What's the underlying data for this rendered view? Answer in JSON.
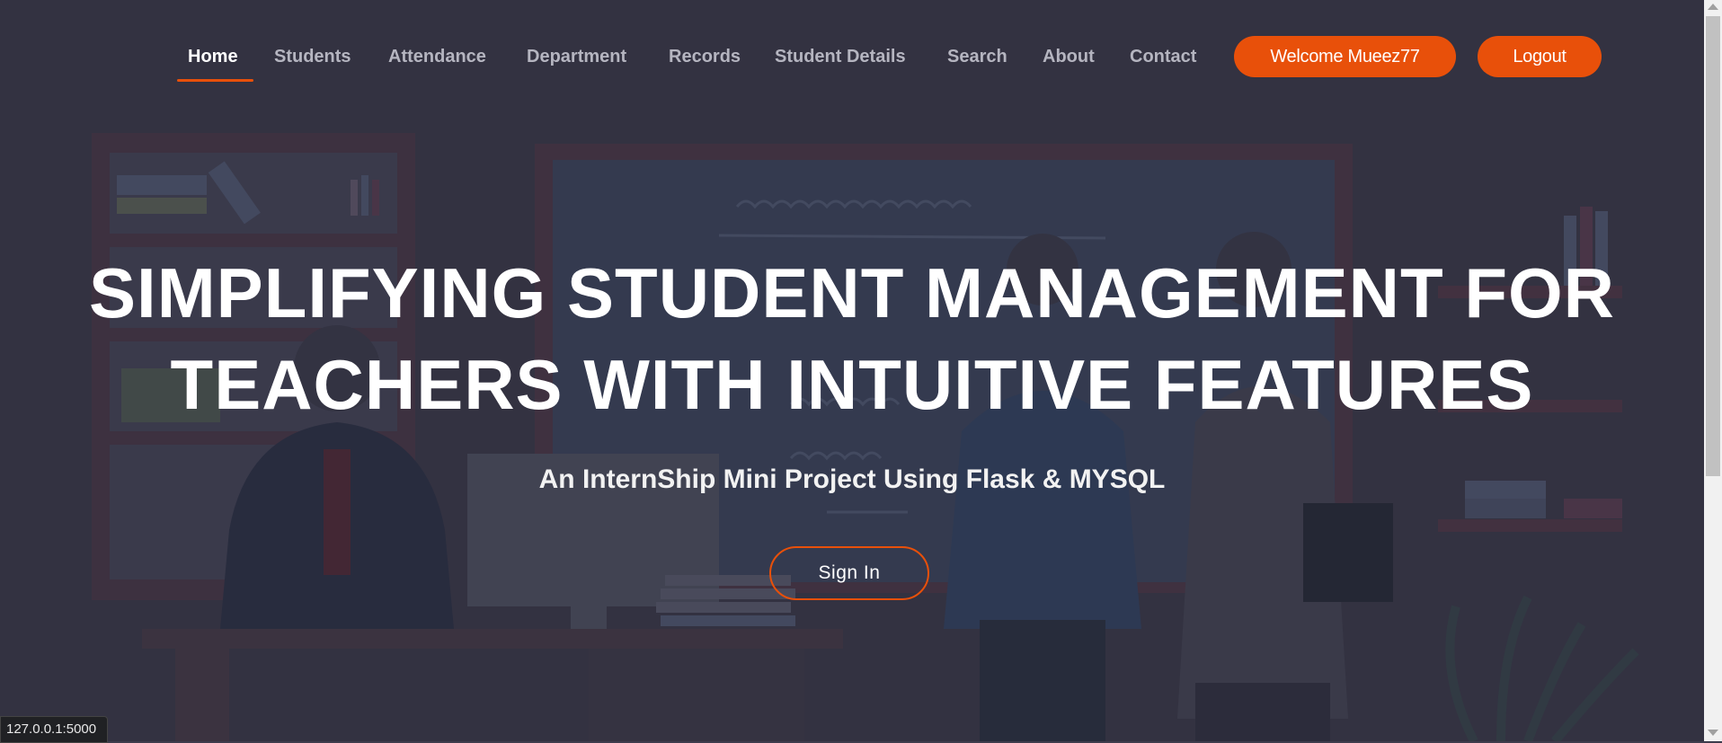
{
  "nav": {
    "items": [
      {
        "label": "Home",
        "active": true
      },
      {
        "label": "Students"
      },
      {
        "label": "Attendance"
      },
      {
        "label": "Department"
      },
      {
        "label": "Records"
      },
      {
        "label": "Student Details"
      },
      {
        "label": "Search"
      },
      {
        "label": "About"
      },
      {
        "label": "Contact"
      }
    ],
    "welcome_label": "Welcome Mueez77",
    "logout_label": "Logout"
  },
  "hero": {
    "title_line1": "SIMPLIFYING STUDENT MANAGEMENT FOR",
    "title_line2": "TEACHERS WITH INTUITIVE FEATURES",
    "subtitle": "An InternShip Mini Project Using Flask & MYSQL",
    "signin_label": "Sign In"
  },
  "status_bar": {
    "url": "127.0.0.1:5000"
  },
  "colors": {
    "accent": "#e8500a",
    "background": "#3d3c4c",
    "text": "#ffffff"
  }
}
